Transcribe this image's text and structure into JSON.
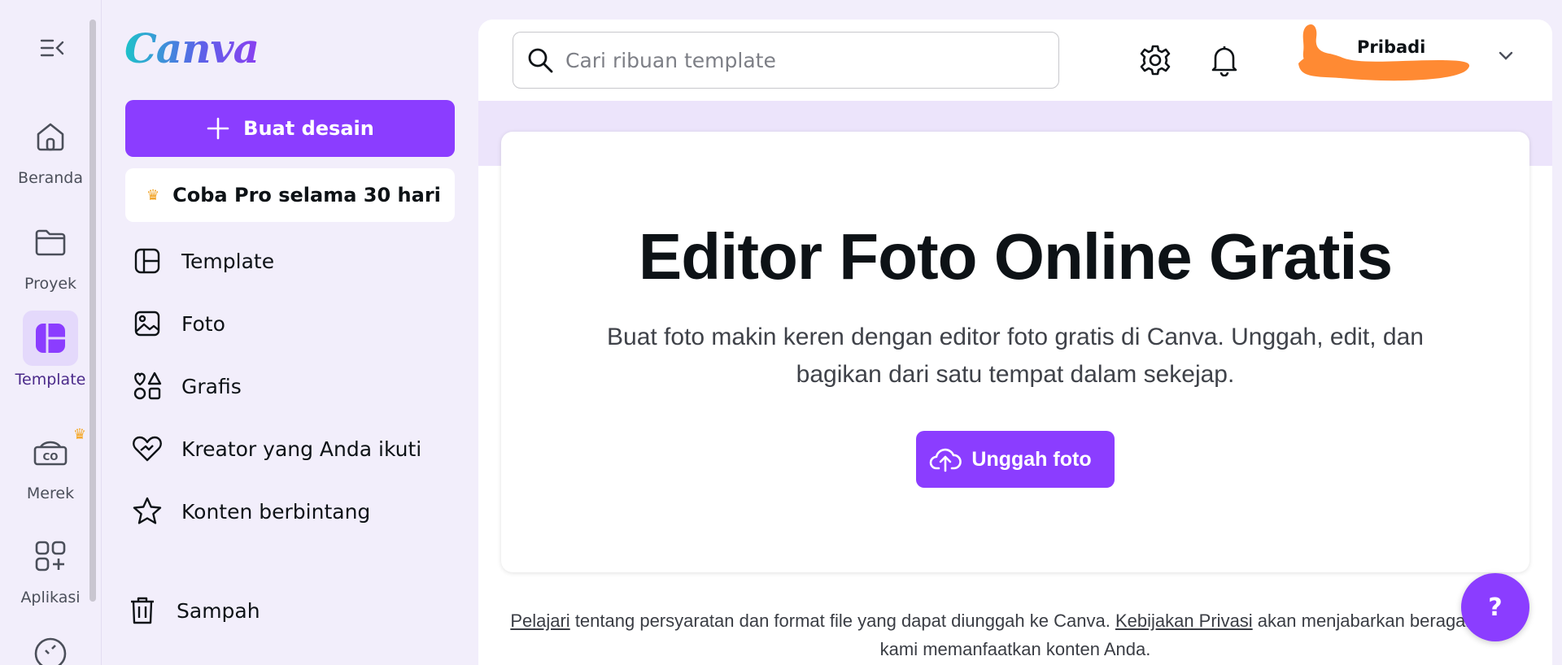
{
  "brand": {
    "logo_text": "Canva",
    "accent": "#8b3dff"
  },
  "rail": {
    "collapse_icon": "collapse-menu-icon",
    "items": [
      {
        "label": "Beranda",
        "icon": "home-icon"
      },
      {
        "label": "Proyek",
        "icon": "folder-icon"
      },
      {
        "label": "Template",
        "icon": "template-icon",
        "active": true
      },
      {
        "label": "Merek",
        "icon": "brand-icon",
        "pro": true
      },
      {
        "label": "Aplikasi",
        "icon": "apps-icon"
      }
    ]
  },
  "panel": {
    "create_label": "Buat desain",
    "pro_label": "Coba Pro selama 30 hari",
    "nav": [
      {
        "label": "Template",
        "icon": "template-icon"
      },
      {
        "label": "Foto",
        "icon": "photo-icon"
      },
      {
        "label": "Grafis",
        "icon": "graphics-icon"
      },
      {
        "label": "Kreator yang Anda ikuti",
        "icon": "heart-icon"
      },
      {
        "label": "Konten berbintang",
        "icon": "star-icon"
      }
    ],
    "trash_label": "Sampah"
  },
  "topbar": {
    "search_placeholder": "Cari ribuan template",
    "account_name": "Pribadi"
  },
  "hero": {
    "title": "Editor Foto Online Gratis",
    "subtitle": "Buat foto makin keren dengan editor foto gratis di Canva. Unggah, edit, dan bagikan dari satu tempat dalam sekejap.",
    "upload_label": "Unggah foto"
  },
  "footer": {
    "link1": "Pelajari",
    "text1": " tentang persyaratan dan format file yang dapat diunggah ke Canva. ",
    "link2": "Kebijakan Privasi",
    "text2": " akan menjabarkan beragam cara",
    "line2": "kami memanfaatkan konten Anda."
  },
  "help": {
    "label": "?"
  }
}
